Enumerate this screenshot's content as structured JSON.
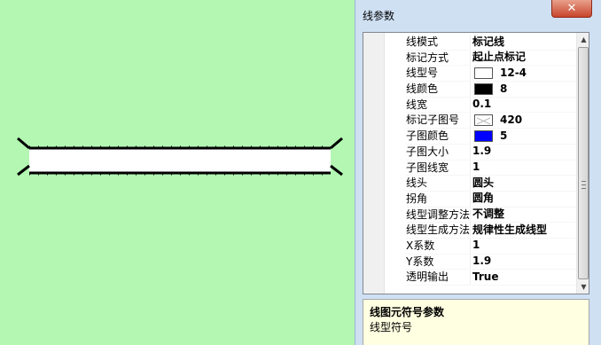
{
  "window": {
    "title": "线参数",
    "close_label": "✕"
  },
  "properties": [
    {
      "name": "线模式",
      "value": "标记线"
    },
    {
      "name": "标记方式",
      "value": "起止点标记"
    },
    {
      "name": "线型号",
      "value": "12-4",
      "swatch": "pattern"
    },
    {
      "name": "线颜色",
      "value": "8",
      "swatch_color": "#000000"
    },
    {
      "name": "线宽",
      "value": "0.1"
    },
    {
      "name": "标记子图号",
      "value": "420",
      "swatch": "pattern"
    },
    {
      "name": "子图颜色",
      "value": "5",
      "swatch_color": "#0000ff"
    },
    {
      "name": "子图大小",
      "value": "1.9"
    },
    {
      "name": "子图线宽",
      "value": "1"
    },
    {
      "name": "线头",
      "value": "圆头"
    },
    {
      "name": "拐角",
      "value": "圆角"
    },
    {
      "name": "线型调整方法",
      "value": "不调整"
    },
    {
      "name": "线型生成方法",
      "value": "规律性生成线型"
    },
    {
      "name": "X系数",
      "value": "1"
    },
    {
      "name": "Y系数",
      "value": "1.9"
    },
    {
      "name": "透明输出",
      "value": "True"
    }
  ],
  "description": {
    "title": "线图元符号参数",
    "text": "线型符号"
  },
  "colors": {
    "canvas_background": "#b3f7b3",
    "line_color": "#000000",
    "fill_color": "#ffffff"
  }
}
